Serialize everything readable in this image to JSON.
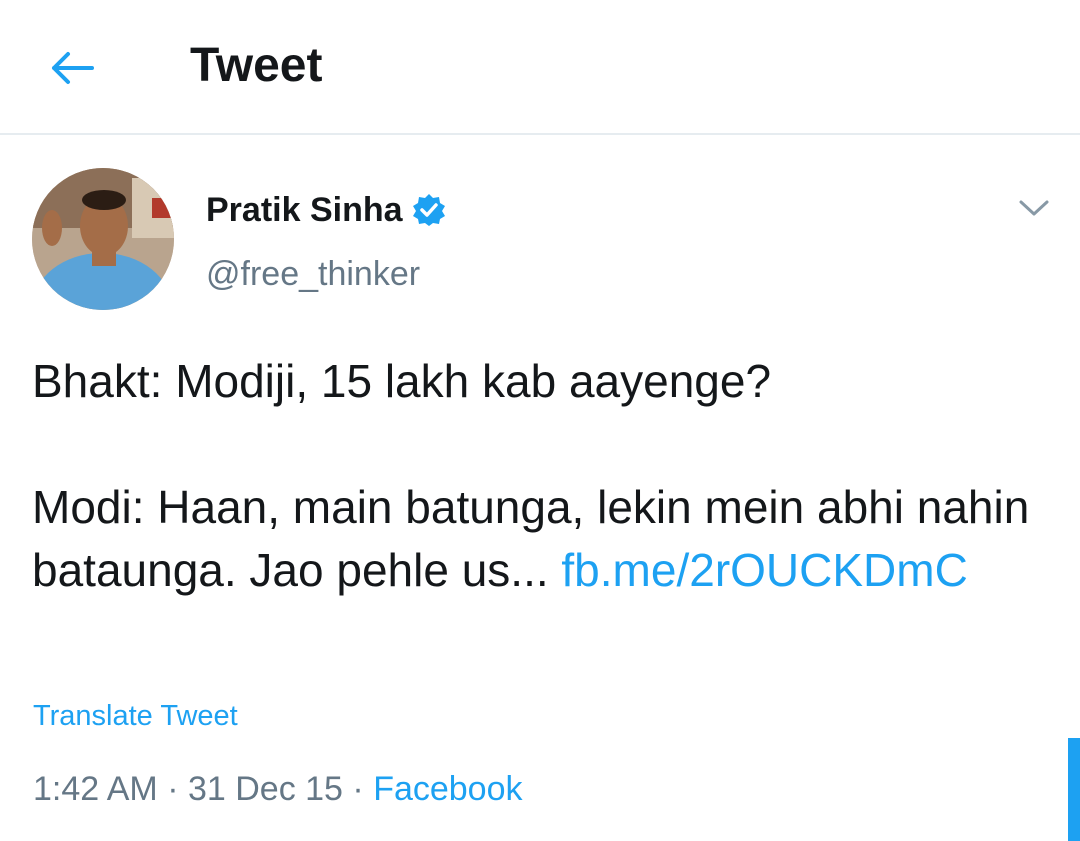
{
  "header": {
    "title": "Tweet",
    "back_icon": "back-arrow-icon"
  },
  "tweet": {
    "author_name": "Pratik Sinha",
    "verified_icon": "verified-badge-icon",
    "handle": "@free_thinker",
    "menu_icon": "chevron-down-icon",
    "text_line1": "Bhakt: Modiji, 15 lakh kab aayenge?",
    "text_line2": "Modi: Haan, main batunga, lekin mein abhi nahin bataunga. Jao pehle us... ",
    "link_text": "fb.me/​2rOUCKDmC",
    "translate_label": "Translate Tweet",
    "time": "1:42 AM",
    "separator": " · ",
    "date": "31 Dec 15",
    "source": "Facebook"
  },
  "colors": {
    "accent": "#1da1f2",
    "text": "#14171a",
    "secondary": "#657786",
    "divider": "#e6ecf0"
  }
}
